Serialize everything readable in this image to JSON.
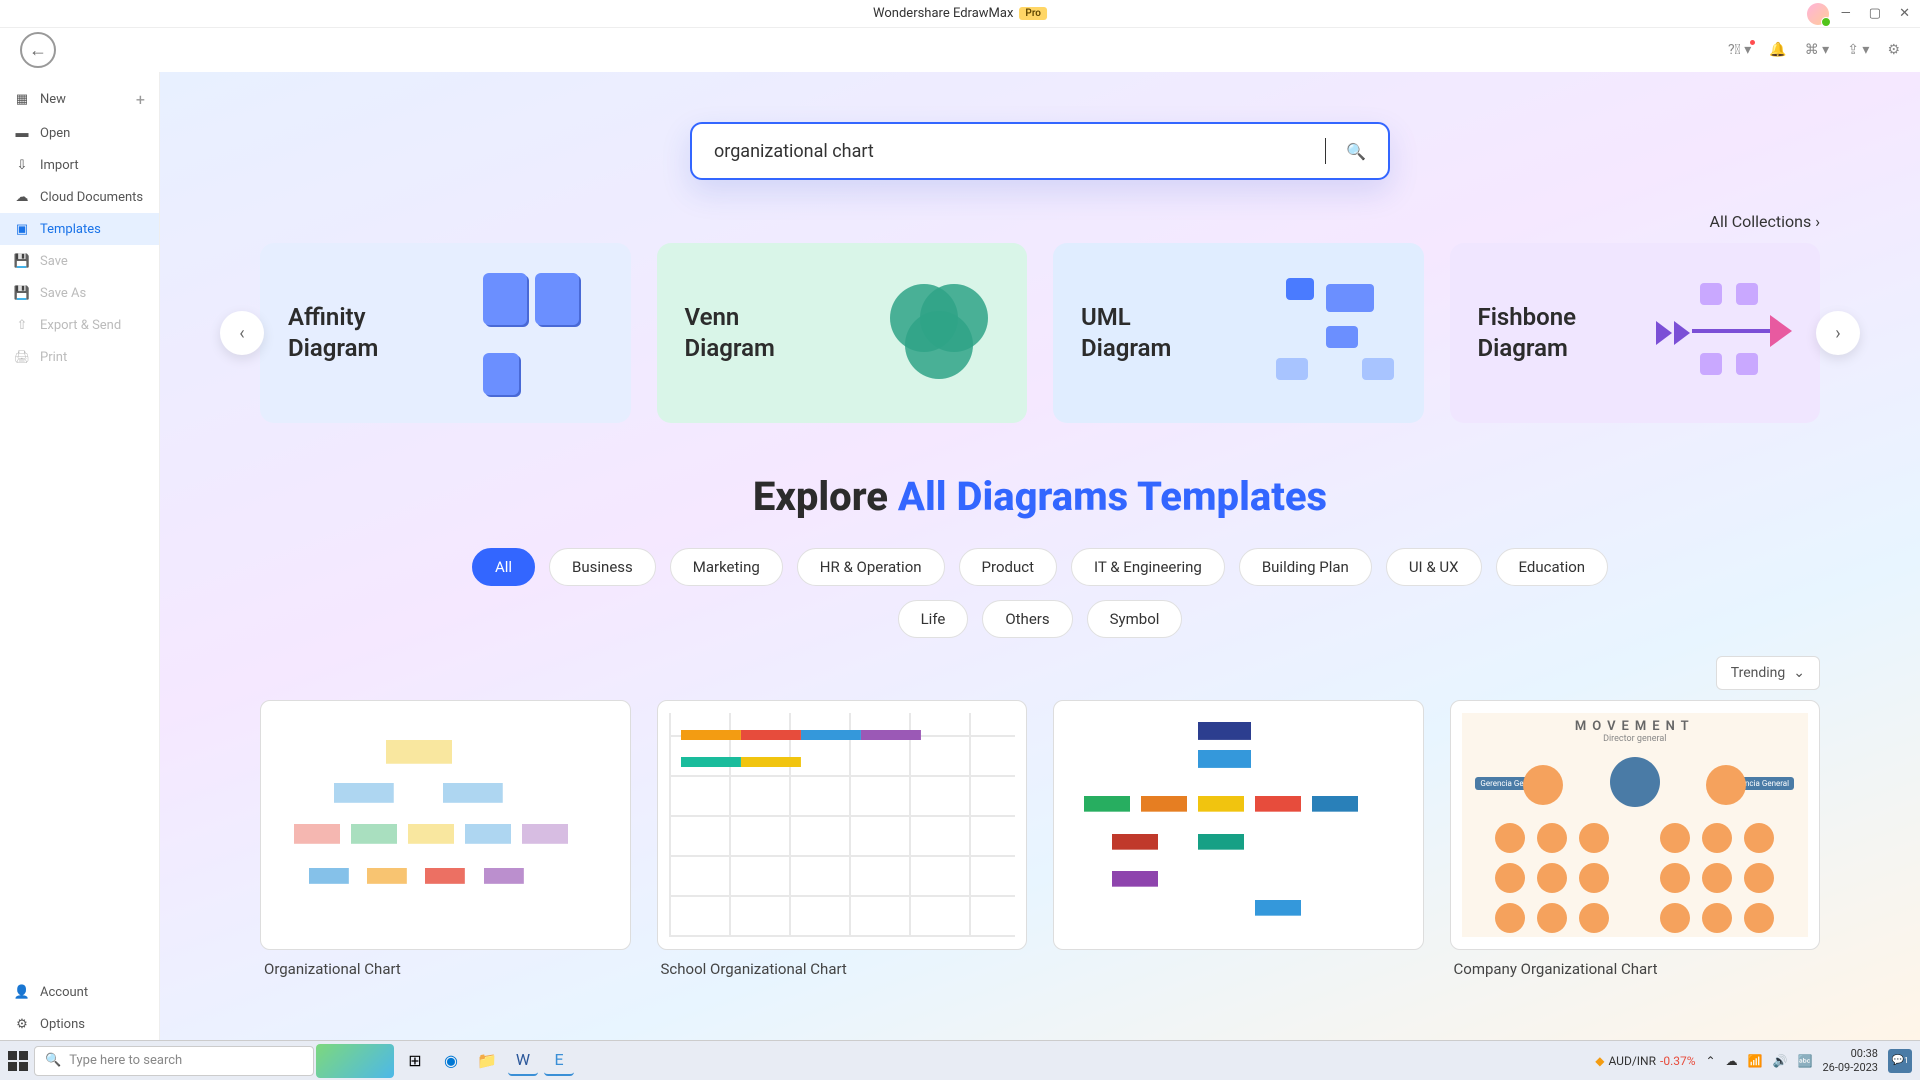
{
  "titlebar": {
    "app_name": "Wondershare EdrawMax",
    "pro_badge": "Pro"
  },
  "toolbar_icons": [
    "help",
    "bell",
    "grid",
    "share",
    "settings"
  ],
  "sidebar": {
    "items": [
      {
        "icon": "plus-square",
        "label": "New",
        "plus": true,
        "disabled": false
      },
      {
        "icon": "folder",
        "label": "Open",
        "disabled": false
      },
      {
        "icon": "download",
        "label": "Import",
        "disabled": false
      },
      {
        "icon": "cloud",
        "label": "Cloud Documents",
        "disabled": false
      },
      {
        "icon": "template",
        "label": "Templates",
        "active": true,
        "disabled": false
      },
      {
        "icon": "save",
        "label": "Save",
        "disabled": true
      },
      {
        "icon": "saveas",
        "label": "Save As",
        "disabled": true
      },
      {
        "icon": "export",
        "label": "Export & Send",
        "disabled": true
      },
      {
        "icon": "print",
        "label": "Print",
        "disabled": true
      }
    ],
    "bottom": [
      {
        "icon": "user",
        "label": "Account"
      },
      {
        "icon": "gear",
        "label": "Options"
      }
    ]
  },
  "search": {
    "value": "organizational chart"
  },
  "all_collections": "All Collections",
  "categories": [
    {
      "key": "affinity",
      "title": "Affinity\nDiagram"
    },
    {
      "key": "venn",
      "title": "Venn\nDiagram"
    },
    {
      "key": "uml",
      "title": "UML\nDiagram"
    },
    {
      "key": "fishbone",
      "title": "Fishbone\nDiagram"
    }
  ],
  "explore": {
    "pre": "Explore ",
    "hl": "All Diagrams Templates"
  },
  "filters": [
    "All",
    "Business",
    "Marketing",
    "HR & Operation",
    "Product",
    "IT & Engineering",
    "Building Plan",
    "UI & UX",
    "Education",
    "Life",
    "Others",
    "Symbol"
  ],
  "sort": "Trending",
  "templates": [
    {
      "title": "Organizational Chart"
    },
    {
      "title": "School Organizational Chart"
    },
    {
      "title": ""
    },
    {
      "title": "Company Organizational Chart"
    }
  ],
  "movement_card": {
    "heading": "MOVEMENT",
    "sub": "Director general",
    "left_badge": "Gerencia General",
    "right_badge": "Gerencia General"
  },
  "taskbar": {
    "search_placeholder": "Type here to search",
    "stock_pair": "AUD/INR",
    "stock_change": "-0.37%",
    "time": "00:38",
    "date": "26-09-2023",
    "notif_count": "1"
  }
}
